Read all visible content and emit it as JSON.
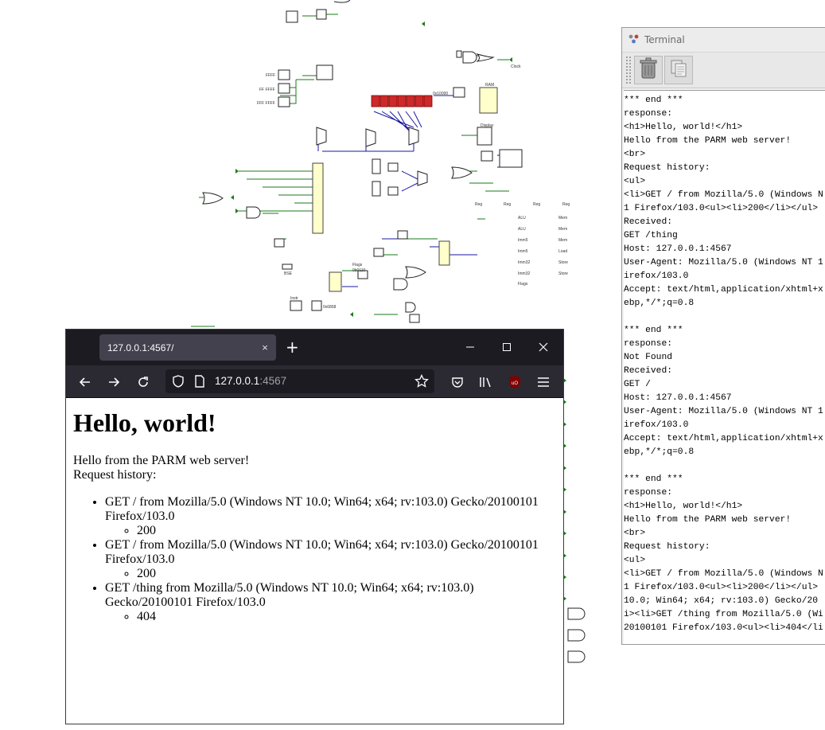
{
  "circuit": {
    "labels": [
      "RAM",
      "Display",
      "Flags",
      "0b0110",
      "Instr",
      "0x6868",
      "0x10000",
      "Clock",
      "FFFF",
      "FF FFFF",
      "FFF FFFF",
      "BSE",
      "Reg",
      "ALU",
      "Imm5",
      "Imm32",
      "Mem",
      "Load",
      "Store"
    ]
  },
  "terminal": {
    "title": "Terminal",
    "toolbar": {
      "clear_icon": "trash-icon",
      "copy_icon": "copy-icon"
    },
    "lines": [
      "*** end ***",
      "response:",
      "<h1>Hello, world!</h1>",
      "Hello from the PARM web server!",
      "<br>",
      "Request history:",
      "<ul>",
      "<li>GET / from Mozilla/5.0 (Windows N",
      "1 Firefox/103.0<ul><li>200</li></ul>",
      "Received:",
      "GET /thing",
      "Host: 127.0.0.1:4567",
      "User-Agent: Mozilla/5.0 (Windows NT 1",
      "irefox/103.0",
      "Accept: text/html,application/xhtml+x",
      "ebp,*/*;q=0.8",
      "",
      "*** end ***",
      "response:",
      "Not Found",
      "Received:",
      "GET /",
      "Host: 127.0.0.1:4567",
      "User-Agent: Mozilla/5.0 (Windows NT 1",
      "irefox/103.0",
      "Accept: text/html,application/xhtml+x",
      "ebp,*/*;q=0.8",
      "",
      "*** end ***",
      "response:",
      "<h1>Hello, world!</h1>",
      "Hello from the PARM web server!",
      "<br>",
      "Request history:",
      "<ul>",
      "<li>GET / from Mozilla/5.0 (Windows N",
      "1 Firefox/103.0<ul><li>200</li></ul>",
      "10.0; Win64; x64; rv:103.0) Gecko/20",
      "i><li>GET /thing from Mozilla/5.0 (Wi",
      "20100101 Firefox/103.0<ul><li>404</li"
    ]
  },
  "browser": {
    "tab_title": "127.0.0.1:4567/",
    "tab_close": "×",
    "new_tab": "+",
    "url_host": "127.0.0.1",
    "url_port": ":4567",
    "icons": {
      "back": "back-arrow-icon",
      "forward": "forward-arrow-icon",
      "reload": "reload-icon",
      "shield": "shield-icon",
      "page": "page-icon",
      "bookmark": "star-icon",
      "pocket": "pocket-icon",
      "library": "library-icon",
      "extension": "ublock-icon",
      "menu": "hamburger-menu-icon",
      "minimize": "minimize-icon",
      "maximize": "maximize-icon",
      "close": "close-icon"
    },
    "page": {
      "heading": "Hello, world!",
      "intro": "Hello from the PARM web server!",
      "history_label": "Request history:",
      "history": [
        {
          "request": "GET / from Mozilla/5.0 (Windows NT 10.0; Win64; x64; rv:103.0) Gecko/20100101 Firefox/103.0",
          "status": "200"
        },
        {
          "request": "GET / from Mozilla/5.0 (Windows NT 10.0; Win64; x64; rv:103.0) Gecko/20100101 Firefox/103.0",
          "status": "200"
        },
        {
          "request": "GET /thing from Mozilla/5.0 (Windows NT 10.0; Win64; x64; rv:103.0) Gecko/20100101 Firefox/103.0",
          "status": "404"
        }
      ]
    }
  }
}
